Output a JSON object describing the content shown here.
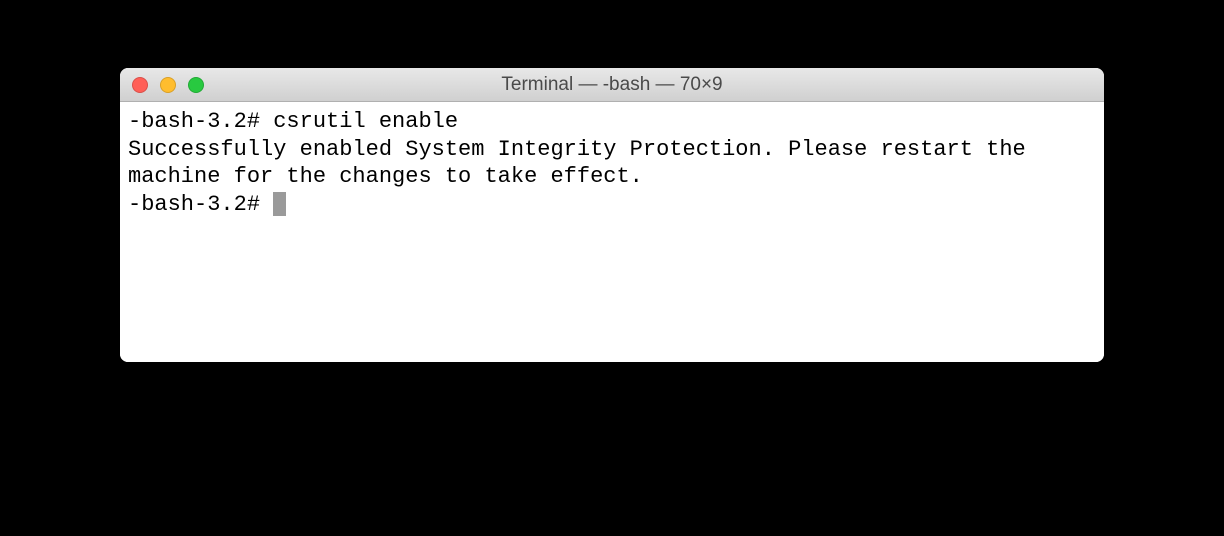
{
  "window": {
    "title": "Terminal — -bash — 70×9"
  },
  "terminal": {
    "line1_prompt": "-bash-3.2# ",
    "line1_command": "csrutil enable",
    "output": "Successfully enabled System Integrity Protection. Please restart the machine for the changes to take effect.",
    "line3_prompt": "-bash-3.2# "
  }
}
